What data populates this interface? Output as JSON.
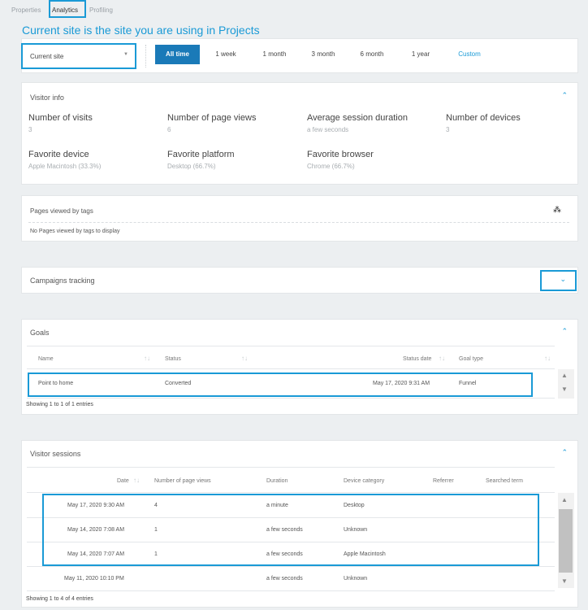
{
  "tabs": {
    "properties": "Properties",
    "analytics": "Analytics",
    "profiling": "Profiling"
  },
  "caption": "Current site is the site you are using in Projects",
  "filters": {
    "site_select": "Current site",
    "ranges": [
      "All time",
      "1 week",
      "1 month",
      "3 month",
      "6 month",
      "1 year",
      "Custom"
    ]
  },
  "visitor_info": {
    "title": "Visitor info",
    "stats": [
      {
        "label": "Number of visits",
        "value": "3"
      },
      {
        "label": "Number of page views",
        "value": "6"
      },
      {
        "label": "Average session duration",
        "value": "a few seconds"
      },
      {
        "label": "Number of devices",
        "value": "3"
      },
      {
        "label": "Favorite device",
        "value": "Apple Macintosh (33.3%)"
      },
      {
        "label": "Favorite platform",
        "value": "Desktop (66.7%)"
      },
      {
        "label": "Favorite browser",
        "value": "Chrome (66.7%)"
      }
    ]
  },
  "pages_by_tags": {
    "title": "Pages viewed by tags",
    "empty": "No Pages viewed by tags to display"
  },
  "campaigns": {
    "title": "Campaigns tracking"
  },
  "goals": {
    "title": "Goals",
    "columns": [
      "Name",
      "Status",
      "Status date",
      "Goal type"
    ],
    "rows": [
      {
        "name": "Point to home",
        "status": "Converted",
        "date": "May 17, 2020 9:31 AM",
        "type": "Funnel"
      }
    ],
    "footer": "Showing 1 to 1 of 1 entries"
  },
  "sessions": {
    "title": "Visitor sessions",
    "columns": [
      "Date",
      "Number of page views",
      "Duration",
      "Device category",
      "Referrer",
      "Searched term"
    ],
    "rows": [
      {
        "date": "May 17, 2020 9:30 AM",
        "views": "4",
        "duration": "a minute",
        "device": "Desktop"
      },
      {
        "date": "May 14, 2020 7:08 AM",
        "views": "1",
        "duration": "a few seconds",
        "device": "Unknown"
      },
      {
        "date": "May 14, 2020 7:07 AM",
        "views": "1",
        "duration": "a few seconds",
        "device": "Apple Macintosh"
      },
      {
        "date": "May 11, 2020 10:10 PM",
        "views": "",
        "duration": "a few seconds",
        "device": "Unknown"
      }
    ],
    "footer": "Showing 1 to 4 of 4 entries"
  },
  "colors": {
    "accent": "#1a9ad6",
    "active_range": "#1a7ab8",
    "background": "#eceff1"
  }
}
